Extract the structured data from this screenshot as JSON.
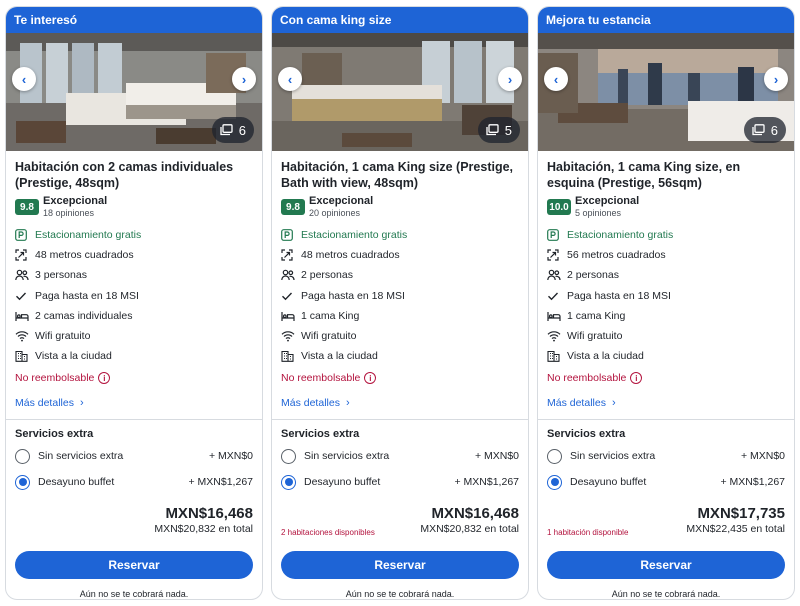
{
  "cards": [
    {
      "banner": "Te interesó",
      "photo_count": "6",
      "title": "Habitación con 2 camas individuales (Prestige, 48sqm)",
      "score": "9.8",
      "rating_label": "Excepcional",
      "reviews": "18 opiniones",
      "amenities": [
        "Estacionamiento gratis",
        "48 metros cuadrados",
        "3 personas",
        "Paga hasta en 18 MSI",
        "2 camas individuales",
        "Wifi gratuito",
        "Vista a la ciudad"
      ],
      "non_refundable": "No reembolsable",
      "more_details": "Más detalles",
      "extras_title": "Servicios extra",
      "options": [
        {
          "label": "Sin servicios extra",
          "price": "+ MXN$0"
        },
        {
          "label": "Desayuno buffet",
          "price": "+ MXN$1,267"
        }
      ],
      "selected_option": "Desayuno buffet",
      "price": "MXN$16,468",
      "total": "MXN$20,832 en total",
      "availability": "",
      "reserve": "Reservar",
      "no_charge": "Aún no se te cobrará nada."
    },
    {
      "banner": "Con cama king size",
      "photo_count": "5",
      "title": "Habitación, 1 cama King size (Prestige, Bath with view, 48sqm)",
      "score": "9.8",
      "rating_label": "Excepcional",
      "reviews": "20 opiniones",
      "amenities": [
        "Estacionamiento gratis",
        "48 metros cuadrados",
        "2 personas",
        "Paga hasta en 18 MSI",
        "1 cama King",
        "Wifi gratuito",
        "Vista a la ciudad"
      ],
      "non_refundable": "No reembolsable",
      "more_details": "Más detalles",
      "extras_title": "Servicios extra",
      "options": [
        {
          "label": "Sin servicios extra",
          "price": "+ MXN$0"
        },
        {
          "label": "Desayuno buffet",
          "price": "+ MXN$1,267"
        }
      ],
      "selected_option": "Desayuno buffet",
      "price": "MXN$16,468",
      "total": "MXN$20,832 en total",
      "availability": "2 habitaciones disponibles",
      "reserve": "Reservar",
      "no_charge": "Aún no se te cobrará nada."
    },
    {
      "banner": "Mejora tu estancia",
      "photo_count": "6",
      "title": "Habitación, 1 cama King size, en esquina (Prestige, 56sqm)",
      "score": "10.0",
      "rating_label": "Excepcional",
      "reviews": "5 opiniones",
      "amenities": [
        "Estacionamiento gratis",
        "56 metros cuadrados",
        "2 personas",
        "Paga hasta en 18 MSI",
        "1 cama King",
        "Wifi gratuito",
        "Vista a la ciudad"
      ],
      "non_refundable": "No reembolsable",
      "more_details": "Más detalles",
      "extras_title": "Servicios extra",
      "options": [
        {
          "label": "Sin servicios extra",
          "price": "+ MXN$0"
        },
        {
          "label": "Desayuno buffet",
          "price": "+ MXN$1,267"
        }
      ],
      "selected_option": "Desayuno buffet",
      "price": "MXN$17,735",
      "total": "MXN$22,435 en total",
      "availability": "1 habitación disponible",
      "reserve": "Reservar",
      "no_charge": "Aún no se te cobrará nada."
    }
  ],
  "amenity_icons": [
    "parking-icon",
    "area-icon",
    "people-icon",
    "checkmark-icon",
    "bed-icon",
    "wifi-icon",
    "city-icon"
  ],
  "colors": {
    "brand_blue": "#1e64d6",
    "rating_green": "#227950",
    "nonrefundable_red": "#b3133e"
  }
}
